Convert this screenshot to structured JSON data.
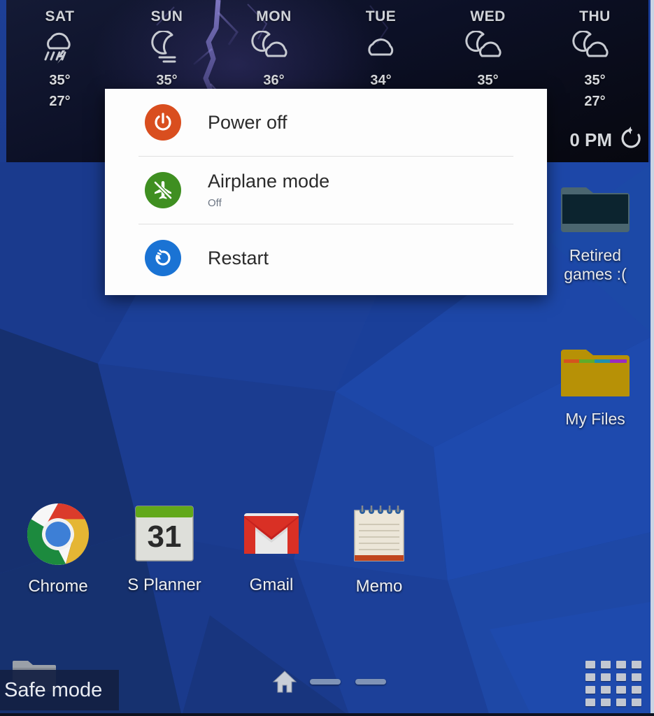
{
  "screen": {
    "wallpaper_color": "#1b3f9c",
    "safe_mode_label": "Safe mode"
  },
  "weather_widget": {
    "background_color": "#0c1026",
    "time_text": "0 PM",
    "refresh_icon": "refresh-icon",
    "days": [
      {
        "day": "SAT",
        "icon": "rain-thunder-icon",
        "high": "35°",
        "low": "27°"
      },
      {
        "day": "SUN",
        "icon": "moon-haze-icon",
        "high": "35°",
        "low": ""
      },
      {
        "day": "MON",
        "icon": "moon-cloud-icon",
        "high": "36°",
        "low": ""
      },
      {
        "day": "TUE",
        "icon": "cloud-icon",
        "high": "34°",
        "low": ""
      },
      {
        "day": "WED",
        "icon": "moon-cloud-icon",
        "high": "35°",
        "low": ""
      },
      {
        "day": "THU",
        "icon": "moon-cloud-icon",
        "high": "35°",
        "low": "27°"
      }
    ]
  },
  "power_dialog": {
    "items": [
      {
        "label": "Power off",
        "subtitle": "",
        "icon": "power-icon",
        "color": "#d94e1f"
      },
      {
        "label": "Airplane mode",
        "subtitle": "Off",
        "icon": "airplane-icon",
        "color": "#3f8f21"
      },
      {
        "label": "Restart",
        "subtitle": "",
        "icon": "restart-icon",
        "color": "#1a73d4"
      }
    ]
  },
  "desktop_folders": [
    {
      "label": "Retired\ngames :(",
      "label_line1": "Retired",
      "label_line2": "games :(",
      "icon": "folder-dark-icon",
      "color": "#0c2430"
    },
    {
      "label": "My Files",
      "label_line1": "My Files",
      "label_line2": "",
      "icon": "folder-yellow-icon",
      "color": "#b79106"
    }
  ],
  "dock_apps": [
    {
      "label": "Chrome",
      "icon": "chrome-icon"
    },
    {
      "label": "S Planner",
      "icon": "calendar-icon",
      "day_number": "31"
    },
    {
      "label": "Gmail",
      "icon": "gmail-icon"
    },
    {
      "label": "Memo",
      "icon": "memo-icon"
    }
  ],
  "navbar": {
    "home_icon": "home-icon",
    "page_indicator_count": 2,
    "apps_grid_icon": "apps-grid-icon"
  }
}
